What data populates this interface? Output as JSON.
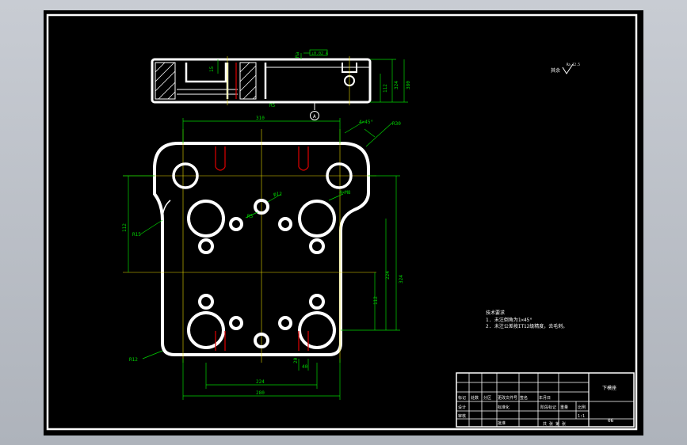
{
  "colors": {
    "background": "#000000",
    "outline": "#ffffff",
    "dimension": "#00d400",
    "centerline": "#e5d800",
    "hidden": "#e00000",
    "chrome": "#b9bec6"
  },
  "dims": {
    "top_width": "310",
    "overall_height": "380",
    "right_height": "324",
    "lower_height": "224",
    "bottom_small": "112",
    "dim_224": "224",
    "dim_280": "280",
    "dim_20": "20",
    "dim_40": "40",
    "r_12": "R12",
    "r_15": "R15",
    "r_5": "R5",
    "r_30": "R30",
    "side_small": "15",
    "side_2_5": "Ra",
    "chamfer": "4×45°",
    "hole_note": "4×M8",
    "center_hole": "φ12"
  },
  "datum": {
    "label": "A",
    "tol_box": "⊥0.02 A"
  },
  "roughness": {
    "label": "其余",
    "symbol": "Ra 12.5"
  },
  "notes": {
    "title": "技术要求",
    "line1": "1. 未注倒角为1×45°",
    "line2": "2. 未注公差按IT12级精度，去毛刺。"
  },
  "title_block": {
    "part_name": "下模座",
    "scale": "1:1",
    "count": "1",
    "drawing_no": "06",
    "designer": "设计",
    "standard": "标准化",
    "approver": "批准",
    "review": "审核",
    "marks": "标记",
    "qty": "处数",
    "zone": "分区",
    "change_doc": "更改文件号",
    "sign": "签名",
    "date": "年月日",
    "stage": "阶段标记",
    "weight": "重量",
    "ratio": "比例",
    "sheets": "共 张 第 张"
  }
}
